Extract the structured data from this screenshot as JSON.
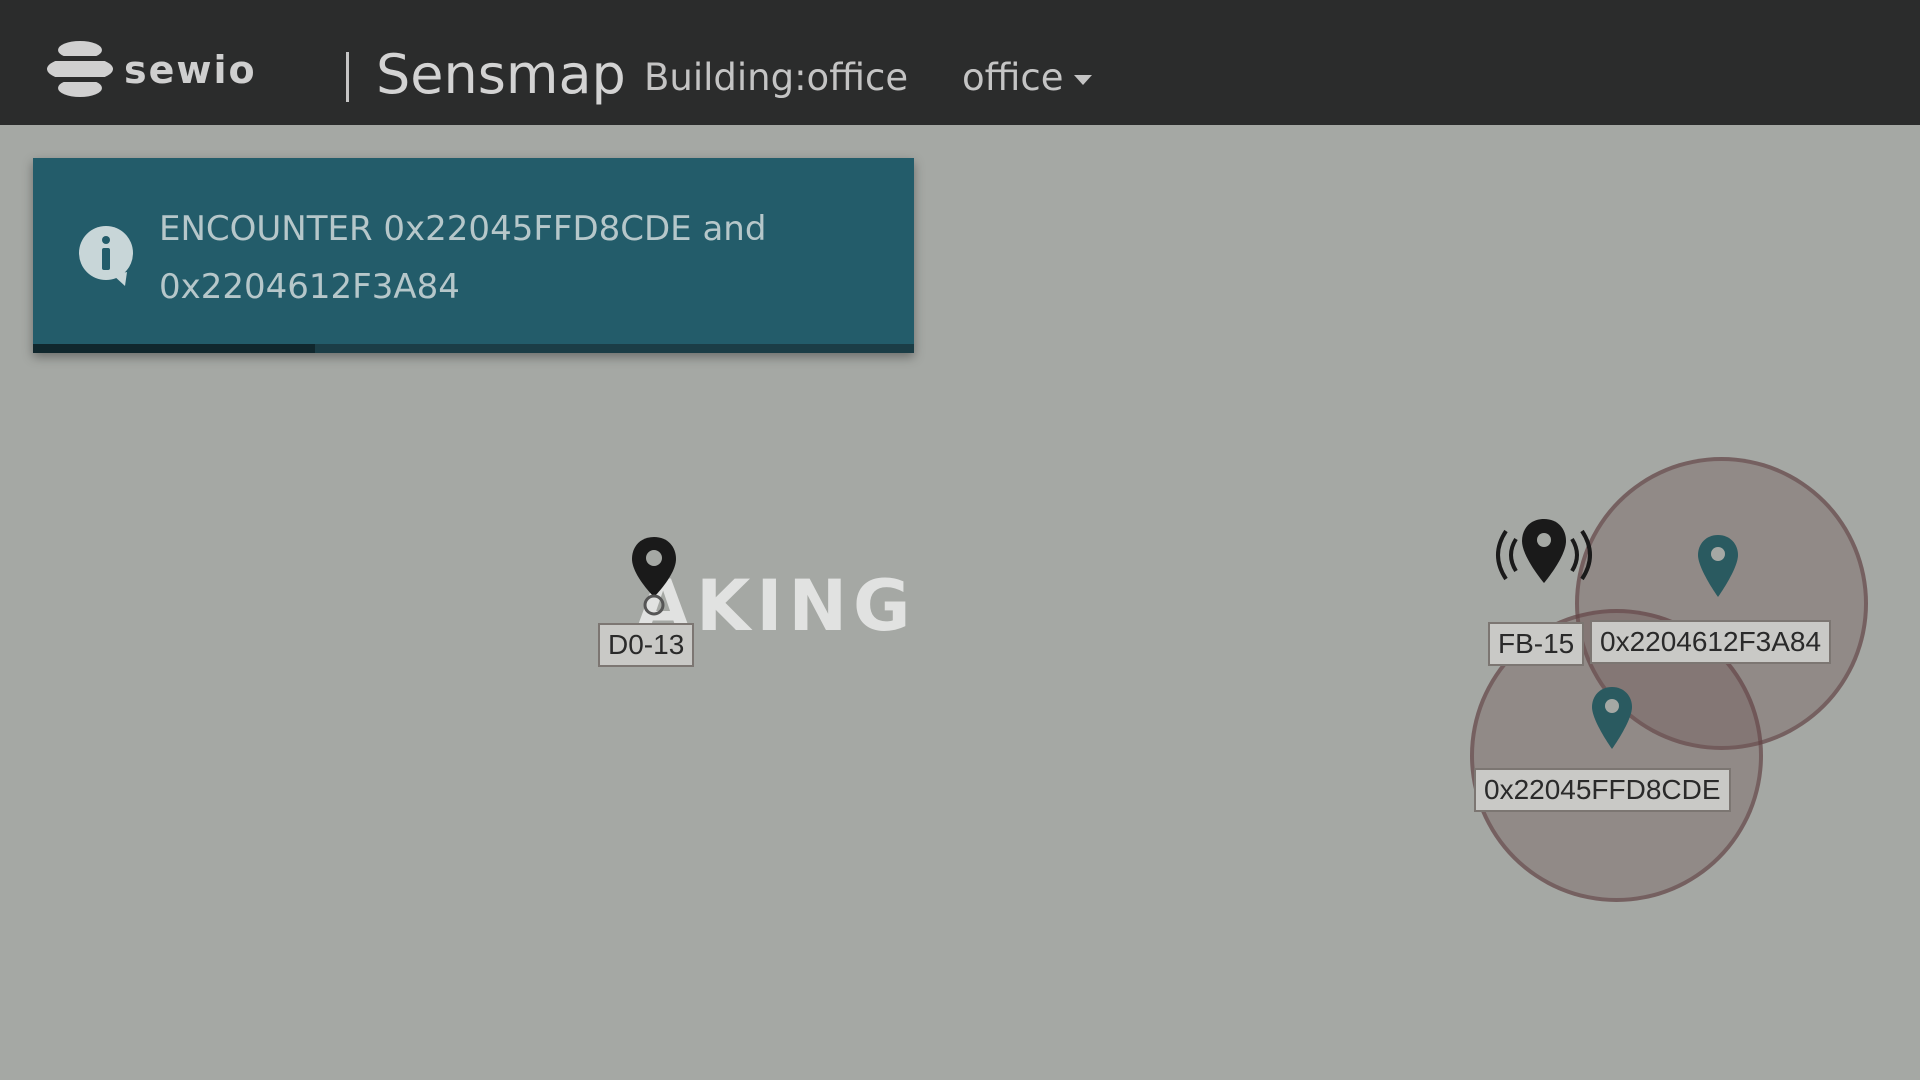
{
  "header": {
    "logo_text": "sewio",
    "app_name": "Sensmap",
    "building": "Building:office",
    "floor": "office"
  },
  "notification": {
    "message": "ENCOUNTER 0x22045FFD8CDE and\n0x2204612F3A84",
    "progress_percent": 32
  },
  "map": {
    "anchors": [
      {
        "label": "D0-13"
      },
      {
        "label": "FB-15"
      }
    ],
    "tags": [
      {
        "label": "0x2204612F3A84"
      },
      {
        "label": "0x22045FFD8CDE"
      }
    ]
  },
  "colors": {
    "navbar": "#2b2c2c",
    "notification": "#235c6a",
    "map_background": "#a5a8a4",
    "tag_marker": "#2a5a60",
    "anchor_marker": "#1a1a1a"
  }
}
